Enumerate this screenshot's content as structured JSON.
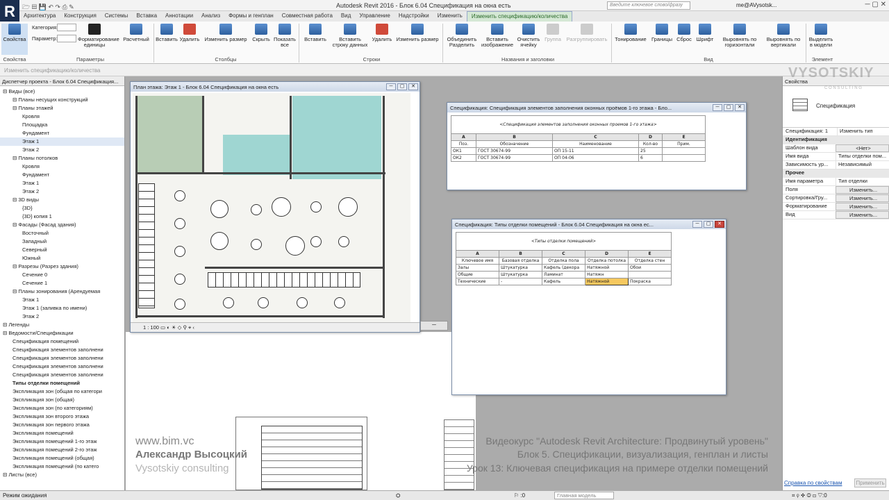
{
  "app": {
    "title": "Autodesk Revit 2016 -   Блок 6.04 Спецификация на окна есть",
    "search_placeholder": "Введите ключевое слово/фразу",
    "user": "me@AVysotsk...",
    "logo": "R"
  },
  "tabs": [
    "Архитектура",
    "Конструкция",
    "Системы",
    "Вставка",
    "Аннотации",
    "Анализ",
    "Формы и генплан",
    "Совместная работа",
    "Вид",
    "Управление",
    "Надстройки",
    "Изменить",
    "Изменить спецификацию/количества"
  ],
  "ribbon": {
    "properties_label": "Свойства",
    "category_label": "Категория:",
    "parameter_label": "Параметр:",
    "format_units": "Форматирование единицы",
    "calculated": "Расчетный",
    "insert": "Вставить",
    "delete": "Удалить",
    "resize": "Изменить размер",
    "hide": "Скрыть",
    "show_all": "Показать все",
    "insert_row": "Вставить",
    "insert_data_row": "Вставить строку данных",
    "delete_row": "Удалить",
    "resize_row": "Изменить размер",
    "merge": "Объединить Разделить",
    "insert_image": "Вставить изображение",
    "clear_cell": "Очистить ячейку",
    "group": "Группа",
    "ungroup": "Разгруппировать",
    "shading": "Тонирование",
    "borders": "Границы",
    "reset": "Сброс",
    "font": "Шрифт",
    "align_h": "Выровнять по горизонтали",
    "align_v": "Выровнять по вертикали",
    "highlight": "Выделить в модели",
    "panels": [
      "Свойства",
      "Параметры",
      "Столбцы",
      "Строки",
      "Названия и заголовки",
      "Вид",
      "Элемент"
    ]
  },
  "subbar": "Изменить спецификацию/количества",
  "project_browser": {
    "title": "Диспетчер проекта - Блок 6.04 Спецификация...",
    "items": [
      {
        "label": "Виды (все)",
        "level": 0,
        "type": "node"
      },
      {
        "label": "Планы несущих конструкций",
        "level": 1,
        "type": "node"
      },
      {
        "label": "Планы этажей",
        "level": 1,
        "type": "node"
      },
      {
        "label": "Кровля",
        "level": 2,
        "type": "leaf"
      },
      {
        "label": "Площадка",
        "level": 2,
        "type": "leaf"
      },
      {
        "label": "Фундамент",
        "level": 2,
        "type": "leaf"
      },
      {
        "label": "Этаж 1",
        "level": 2,
        "type": "sel"
      },
      {
        "label": "Этаж 2",
        "level": 2,
        "type": "leaf"
      },
      {
        "label": "Планы потолков",
        "level": 1,
        "type": "node"
      },
      {
        "label": "Кровля",
        "level": 2,
        "type": "leaf"
      },
      {
        "label": "Фундамент",
        "level": 2,
        "type": "leaf"
      },
      {
        "label": "Этаж 1",
        "level": 2,
        "type": "leaf"
      },
      {
        "label": "Этаж 2",
        "level": 2,
        "type": "leaf"
      },
      {
        "label": "3D виды",
        "level": 1,
        "type": "node"
      },
      {
        "label": "{3D}",
        "level": 2,
        "type": "leaf"
      },
      {
        "label": "{3D} копия 1",
        "level": 2,
        "type": "leaf"
      },
      {
        "label": "Фасады (Фасад здания)",
        "level": 1,
        "type": "node"
      },
      {
        "label": "Восточный",
        "level": 2,
        "type": "leaf"
      },
      {
        "label": "Западный",
        "level": 2,
        "type": "leaf"
      },
      {
        "label": "Северный",
        "level": 2,
        "type": "leaf"
      },
      {
        "label": "Южный",
        "level": 2,
        "type": "leaf"
      },
      {
        "label": "Разрезы (Разрез здания)",
        "level": 1,
        "type": "node"
      },
      {
        "label": "Сечение 0",
        "level": 2,
        "type": "leaf"
      },
      {
        "label": "Сечение 1",
        "level": 2,
        "type": "leaf"
      },
      {
        "label": "Планы зонирования (Арендуемая",
        "level": 1,
        "type": "node"
      },
      {
        "label": "Этаж 1",
        "level": 2,
        "type": "leaf"
      },
      {
        "label": "Этаж 1 (заливка по имени)",
        "level": 2,
        "type": "leaf"
      },
      {
        "label": "Этаж 2",
        "level": 2,
        "type": "leaf"
      },
      {
        "label": "Легенды",
        "level": 0,
        "type": "node"
      },
      {
        "label": "Ведомости/Спецификации",
        "level": 0,
        "type": "node"
      },
      {
        "label": "Спецификация помещений",
        "level": 1,
        "type": "leaf"
      },
      {
        "label": "Спецификация элементов заполнени",
        "level": 1,
        "type": "leaf"
      },
      {
        "label": "Спецификация элементов заполнени",
        "level": 1,
        "type": "leaf"
      },
      {
        "label": "Спецификация элементов заполнени",
        "level": 1,
        "type": "leaf"
      },
      {
        "label": "Спецификация элементов заполнени",
        "level": 1,
        "type": "leaf"
      },
      {
        "label": "Типы отделки помещений",
        "level": 1,
        "type": "bold"
      },
      {
        "label": "Экспликация зон (общая по категори",
        "level": 1,
        "type": "leaf"
      },
      {
        "label": "Экспликация зон (общая)",
        "level": 1,
        "type": "leaf"
      },
      {
        "label": "Экспликация зон (по категориям)",
        "level": 1,
        "type": "leaf"
      },
      {
        "label": "Экспликация зон второго этажа",
        "level": 1,
        "type": "leaf"
      },
      {
        "label": "Экспликация зон первого этажа",
        "level": 1,
        "type": "leaf"
      },
      {
        "label": "Экспликация помещений",
        "level": 1,
        "type": "leaf"
      },
      {
        "label": "Экспликация помещений 1-го этаж",
        "level": 1,
        "type": "leaf"
      },
      {
        "label": "Экспликация помещений 2-го этаж",
        "level": 1,
        "type": "leaf"
      },
      {
        "label": "Экспликация помещений (общая)",
        "level": 1,
        "type": "leaf"
      },
      {
        "label": "Экспликация помещений (по катего",
        "level": 1,
        "type": "leaf"
      },
      {
        "label": "Листы (все)",
        "level": 0,
        "type": "node"
      }
    ]
  },
  "plan_window": {
    "title": "План этажа: Этаж 1 - Блок 6.04 Спецификация на окна есть",
    "scale": "1 : 100"
  },
  "schedule1": {
    "title": "Спецификация: Спецификация элементов заполнения оконных проёмов 1-го этажа - Бло...",
    "header": "<Спецификация элементов заполнения оконных проемов 1-го этажа>",
    "cols": [
      "A",
      "B",
      "C",
      "D",
      "E"
    ],
    "col_names": [
      "Поз.",
      "Обозначение",
      "Наименование",
      "Кол-во",
      "Прим."
    ],
    "rows": [
      [
        "ОК1",
        "ГОСТ 30674-99",
        "ОП 15-11",
        "25",
        ""
      ],
      [
        "ОК2",
        "ГОСТ 30674-99",
        "ОП 04-06",
        "6",
        ""
      ]
    ]
  },
  "schedule2": {
    "title": "Спецификация: Типы отделки помещений - Блок 6.04 Спецификация на окна ес...",
    "header": "<Типы отделки помещений>",
    "cols": [
      "A",
      "B",
      "C",
      "D",
      "E"
    ],
    "col_names": [
      "Ключевое имя",
      "Базовая отделка",
      "Отделка пола",
      "Отделка потолка",
      "Отделка стен"
    ],
    "rows": [
      [
        "Залы",
        "Штукатурка",
        "Кафель (декора",
        "Натяжной",
        "Обои"
      ],
      [
        "Общие",
        "Штукатурка",
        "Ламинат",
        "Натяжн",
        ""
      ],
      [
        "Технические",
        "-",
        "Кафель",
        "Натяжной",
        "Покраска"
      ]
    ]
  },
  "properties": {
    "title": "Свойства",
    "type_name": "Спецификация",
    "selector": "Спецификация: 1",
    "edit_type": "Изменить тип",
    "groups": [
      {
        "name": "Идентификация",
        "rows": [
          [
            "Шаблон вида",
            "<Нет>"
          ],
          [
            "Имя вида",
            "Типы отделки пом..."
          ],
          [
            "Зависимость ур...",
            "Независимый"
          ]
        ]
      },
      {
        "name": "Прочее",
        "rows": [
          [
            "Имя параметра",
            "Тип отделки"
          ],
          [
            "Поля",
            "Изменить..."
          ],
          [
            "Сортировка/Гру...",
            "Изменить..."
          ],
          [
            "Форматирование",
            "Изменить..."
          ],
          [
            "Вид",
            "Изменить..."
          ]
        ]
      }
    ],
    "help_link": "Справка по свойствам",
    "apply": "Применить"
  },
  "watermark": {
    "site": "www.bim.vc",
    "author": "Александр Высоцкий",
    "company": "Vysotskiy consulting",
    "brand": "VYSOTSKIY",
    "brand_sub": "C O N S U L T I N G",
    "course": "Видеокурс \"Autodesk Revit Architecture: Продвинутый уровень\"",
    "block": "Блок 5. Спецификации, визуализация, генплан и листы",
    "lesson": "Урок 13: Ключевая спецификация на примере отделки помещений"
  },
  "status": {
    "text": "Режим ожидания",
    "coord": ":0",
    "model": "Главная модель"
  },
  "colors": {
    "accent": "#2d5f9e",
    "room_teal": "#9fd6d2",
    "room_green": "#b8cdb5"
  }
}
